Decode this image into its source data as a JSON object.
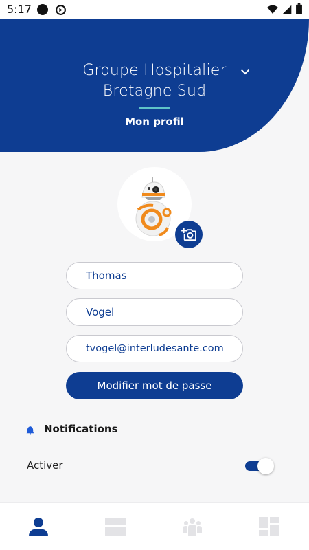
{
  "status_bar": {
    "time": "5:17",
    "icons": [
      "circle-icon",
      "data-saver-icon",
      "wifi-icon",
      "signal-icon",
      "battery-icon"
    ]
  },
  "header": {
    "title": "Groupe Hospitalier Bretagne Sud",
    "subtitle": "Mon profil",
    "chevron_icon": "chevron-down-icon"
  },
  "profile": {
    "avatar_icon": "bb8-avatar",
    "camera_icon": "add-photo-icon",
    "first_name": "Thomas",
    "last_name": "Vogel",
    "email": "tvogel@interludesante.com",
    "change_password_label": "Modifier mot de passe"
  },
  "notifications": {
    "title": "Notifications",
    "icon": "bell-icon",
    "toggle_label": "Activer",
    "enabled": true
  },
  "bottom_nav": {
    "items": [
      {
        "icon": "person-icon",
        "active": true
      },
      {
        "icon": "list-view-icon",
        "active": false
      },
      {
        "icon": "group-icon",
        "active": false
      },
      {
        "icon": "dashboard-icon",
        "active": false
      }
    ]
  },
  "colors": {
    "brand_blue": "#0e3d92",
    "accent_teal": "#5fc3c8",
    "background": "#f6f6f7",
    "inactive_icon": "#e3e3e6"
  }
}
